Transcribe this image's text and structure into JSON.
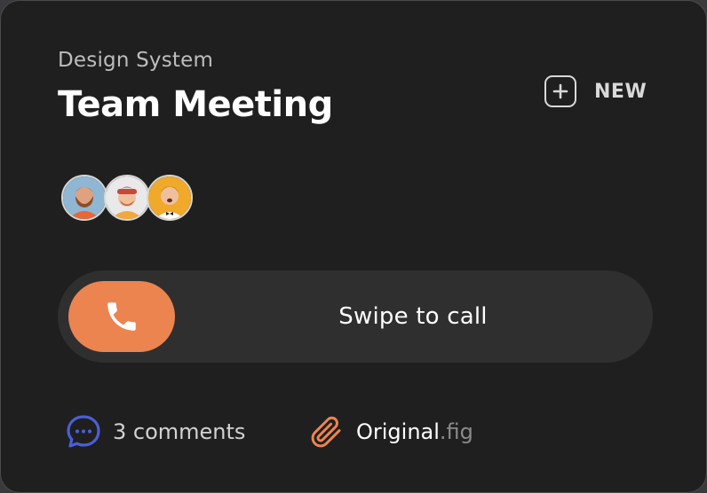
{
  "card": {
    "subtitle": "Design System",
    "title": "Team Meeting"
  },
  "new_button": {
    "icon": "plus-square-icon",
    "label": "NEW"
  },
  "avatars": [
    {
      "name": "avatar-1",
      "bg": "#8fb6d2",
      "shirt": "#e8673a",
      "skin": "#e0a17f",
      "hair": "#8a4e2a"
    },
    {
      "name": "avatar-2",
      "bg": "#e9e9e9",
      "shirt": "#f2a93b",
      "skin": "#f0bf9c",
      "hair": "#c7483a"
    },
    {
      "name": "avatar-3",
      "bg": "#f1a92a",
      "shirt": "#ffffff",
      "skin": "#efc09d",
      "hair": "#6b3b1f"
    }
  ],
  "swipe": {
    "icon": "phone-icon",
    "label": "Swipe to call"
  },
  "footer": {
    "comments_icon": "chat-bubble-icon",
    "comments_label": "3 comments",
    "attachment_icon": "paperclip-icon",
    "file_name": "Original",
    "file_ext": ".fig"
  },
  "colors": {
    "accent_orange": "#ec8450",
    "chat_blue": "#4b5ed8",
    "card_bg": "#1f1f1f",
    "track_bg": "#2f2f2f"
  }
}
